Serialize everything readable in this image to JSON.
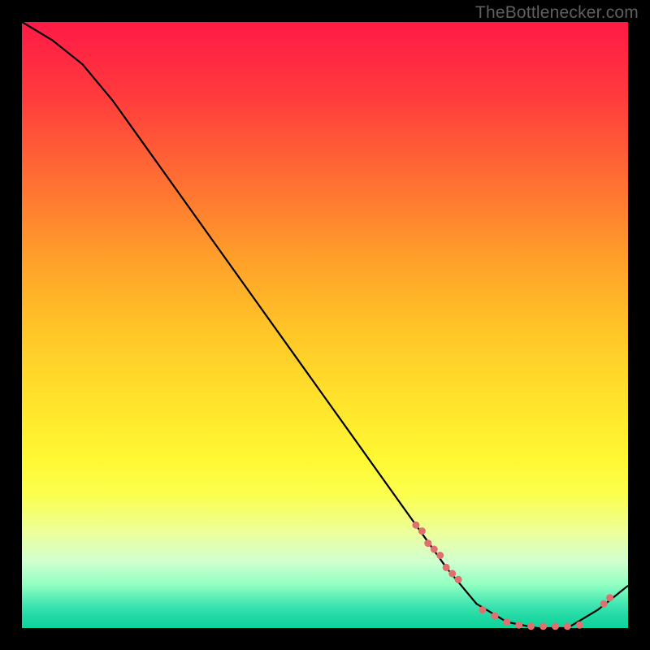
{
  "credit_text": "TheBottlenecker.com",
  "colors": {
    "dot": "#e06f6f",
    "curve": "#000000",
    "frame": "#000000"
  },
  "chart_data": {
    "type": "line",
    "title": "",
    "xlabel": "",
    "ylabel": "",
    "xlim": [
      0,
      100
    ],
    "ylim": [
      0,
      100
    ],
    "grid": false,
    "legend": false,
    "note": "Axes have no tick labels; values are estimated relative percentages. The curve is a V-shape descending from top-left to a flat trough around x≈75–90 then rising slightly at the right edge.",
    "series": [
      {
        "name": "curve",
        "x": [
          0,
          5,
          10,
          15,
          20,
          25,
          30,
          35,
          40,
          45,
          50,
          55,
          60,
          65,
          70,
          75,
          80,
          85,
          90,
          95,
          100
        ],
        "y": [
          100,
          97,
          93,
          87,
          80,
          73,
          66,
          59,
          52,
          45,
          38,
          31,
          24,
          17,
          10,
          4,
          1,
          0,
          0,
          3,
          7
        ]
      }
    ],
    "points": {
      "name": "sample-dots",
      "comment": "Pink dots clustered on the descending segment near x≈65–72 and along the flat trough x≈75–92, plus two at far right rising edge.",
      "x": [
        65,
        66,
        67,
        68,
        69,
        70,
        71,
        72,
        76,
        78,
        80,
        82,
        84,
        86,
        88,
        90,
        92,
        96,
        97
      ],
      "y": [
        17,
        16,
        14,
        13,
        12,
        10,
        9,
        8,
        3,
        2,
        1,
        0.5,
        0.3,
        0.3,
        0.3,
        0.3,
        0.5,
        4,
        5
      ]
    }
  }
}
